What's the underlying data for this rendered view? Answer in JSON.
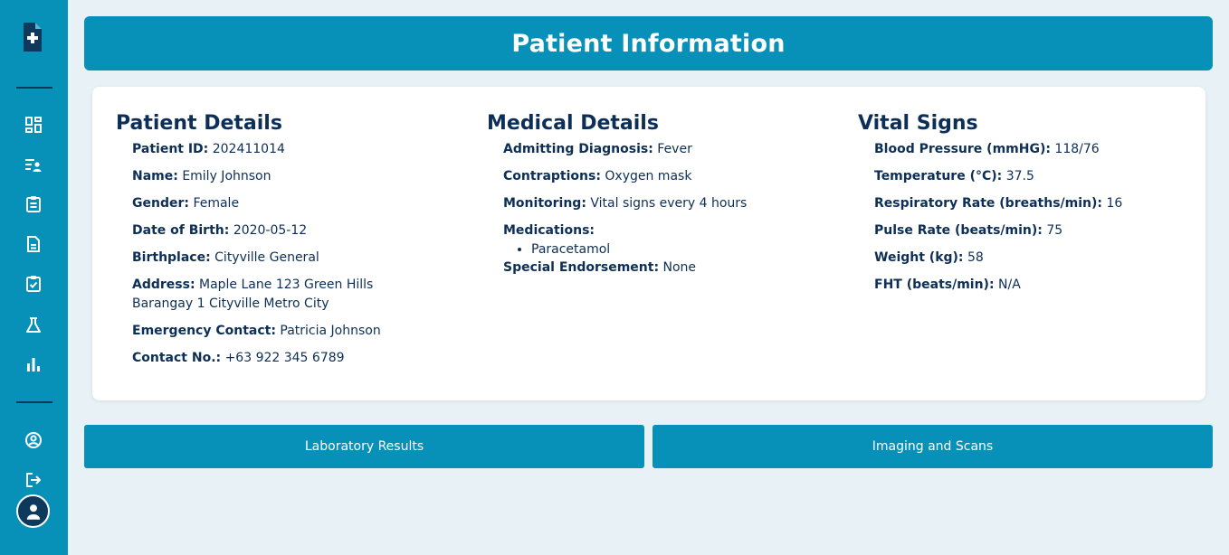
{
  "header": {
    "title": "Patient Information"
  },
  "sidebar": {
    "icons": [
      "logo-document-plus-icon",
      "dashboard-icon",
      "patient-list-icon",
      "clipboard-icon",
      "document-icon",
      "checklist-icon",
      "lab-flask-icon",
      "bar-chart-icon",
      "user-circle-icon",
      "logout-icon",
      "avatar-icon"
    ]
  },
  "patient_details": {
    "title": "Patient Details",
    "patient_id": {
      "label": "Patient ID:",
      "value": "202411014"
    },
    "name": {
      "label": "Name:",
      "value": "Emily Johnson"
    },
    "gender": {
      "label": "Gender:",
      "value": "Female"
    },
    "dob": {
      "label": "Date of Birth:",
      "value": "2020-05-12"
    },
    "birthplace": {
      "label": "Birthplace:",
      "value": "Cityville General"
    },
    "address": {
      "label": "Address:",
      "value": "Maple Lane 123 Green Hills Barangay 1 Cityville Metro City"
    },
    "emergency_contact": {
      "label": "Emergency Contact:",
      "value": "Patricia Johnson"
    },
    "contact_no": {
      "label": "Contact No.:",
      "value": "+63 922 345 6789"
    }
  },
  "medical_details": {
    "title": "Medical Details",
    "admitting_diagnosis": {
      "label": "Admitting Diagnosis:",
      "value": "Fever"
    },
    "contraptions": {
      "label": "Contraptions:",
      "value": "Oxygen mask"
    },
    "monitoring": {
      "label": "Monitoring:",
      "value": "Vital signs every 4 hours"
    },
    "medications": {
      "label": "Medications:",
      "items": [
        "Paracetamol"
      ]
    },
    "special_endorsement": {
      "label": "Special Endorsement:",
      "value": "None"
    }
  },
  "vital_signs": {
    "title": "Vital Signs",
    "blood_pressure": {
      "label": "Blood Pressure (mmHG):",
      "value": "118/76"
    },
    "temperature": {
      "label": "Temperature (°C):",
      "value": "37.5"
    },
    "respiratory_rate": {
      "label": "Respiratory Rate (breaths/min):",
      "value": "16"
    },
    "pulse_rate": {
      "label": "Pulse Rate (beats/min):",
      "value": "75"
    },
    "weight": {
      "label": "Weight (kg):",
      "value": "58"
    },
    "fht": {
      "label": "FHT (beats/min):",
      "value": "N/A"
    }
  },
  "buttons": {
    "lab_results": "Laboratory Results",
    "imaging": "Imaging and Scans"
  },
  "colors": {
    "primary": "#0790b8",
    "dark_navy": "#0d2f57",
    "background": "#e8f1f5"
  }
}
